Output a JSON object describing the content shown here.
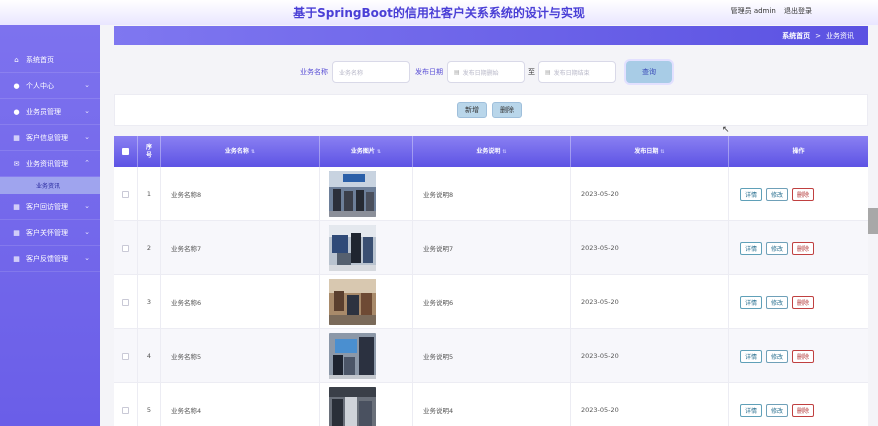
{
  "header": {
    "title": "基于SpringBoot的信用社客户关系系统的设计与实现",
    "user_label": "管理员 admin",
    "logout_label": "退出登录"
  },
  "sidebar": {
    "items": [
      {
        "label": "系统首页",
        "icon": "home-icon"
      },
      {
        "label": "个人中心",
        "icon": "user-icon"
      },
      {
        "label": "业务员管理",
        "icon": "user-icon"
      },
      {
        "label": "客户信息管理",
        "icon": "grid-icon"
      },
      {
        "label": "业务资讯管理",
        "icon": "mail-icon"
      },
      {
        "label": "客户回访管理",
        "icon": "grid-icon"
      },
      {
        "label": "客户关怀管理",
        "icon": "grid-icon"
      },
      {
        "label": "客户反馈管理",
        "icon": "grid-icon"
      }
    ],
    "submenu_active": "业务资讯"
  },
  "breadcrumb": {
    "home": "系统首页",
    "separator": ">",
    "current": "业务资讯"
  },
  "search": {
    "name_label": "业务名称",
    "name_placeholder": "业务名称",
    "date_label": "发布日期",
    "date_start_placeholder": "发布日期删始",
    "date_separator": "至",
    "date_end_placeholder": "发布日期结束",
    "query_button": "查询"
  },
  "actions": {
    "add_button": "新增",
    "delete_button": "删除"
  },
  "table": {
    "columns": [
      "序号",
      "业务名称",
      "业务图片",
      "业务说明",
      "发布日期",
      "操作"
    ],
    "rows": [
      {
        "index": "1",
        "name": "业务名称8",
        "desc": "业务说明8",
        "date": "2023-05-20"
      },
      {
        "index": "2",
        "name": "业务名称7",
        "desc": "业务说明7",
        "date": "2023-05-20"
      },
      {
        "index": "3",
        "name": "业务名称6",
        "desc": "业务说明6",
        "date": "2023-05-20"
      },
      {
        "index": "4",
        "name": "业务名称5",
        "desc": "业务说明5",
        "date": "2023-05-20"
      },
      {
        "index": "5",
        "name": "业务名称4",
        "desc": "业务说明4",
        "date": "2023-05-20"
      }
    ],
    "ops": {
      "detail": "详情",
      "edit": "修改",
      "delete": "删除"
    }
  },
  "colors": {
    "accent": "#5d53e4",
    "sidebar": "#7368ec",
    "title": "#4a3fd6"
  }
}
